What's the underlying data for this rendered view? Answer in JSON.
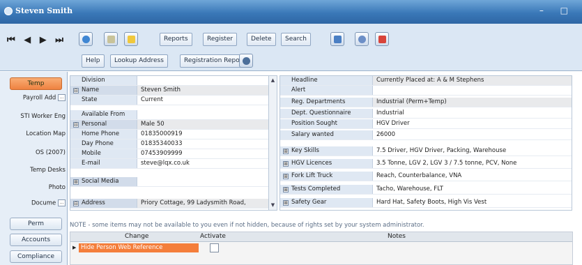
{
  "window": {
    "title": "Steven Smith",
    "controls": "– □"
  },
  "toolbar": {
    "nav_glyphs": "◄◄◄►►►",
    "nav": {
      "first": "⏮",
      "prev": "◀",
      "next": "▶",
      "last": "⏭"
    },
    "reports_label": "Reports",
    "register_label": "Register",
    "delete_label": "Delete",
    "search_label": "Search",
    "help_label": "Help",
    "lookup_address_label": "Lookup Address",
    "registration_report_label": "Registration Report",
    "accent": "#3a78b8"
  },
  "sidebar": {
    "tabs": [
      {
        "label": "Temp",
        "active": true
      },
      {
        "label": "Perm"
      },
      {
        "label": "Accounts"
      },
      {
        "label": "Compliance"
      }
    ],
    "items": [
      {
        "label": "Payroll Add",
        "selector": "…"
      },
      {
        "label": "STI Worker Eng"
      },
      {
        "label": "Location Map"
      },
      {
        "label": "OS (2007)"
      },
      {
        "label": "Temp Desks"
      },
      {
        "label": "Photo"
      },
      {
        "label": "Docume",
        "selector": "…"
      }
    ]
  },
  "left_grid": {
    "rows": [
      {
        "label": "Division",
        "value": ""
      },
      {
        "label": "Name",
        "value": "Steven Smith",
        "expander": "⊟"
      },
      {
        "label": "State",
        "value": "Current"
      },
      {
        "label": "Available From",
        "value": ""
      },
      {
        "label": "Personal",
        "value": "Male 50",
        "expander": "⊟"
      },
      {
        "label": "Home Phone",
        "value": "01835000919"
      },
      {
        "label": "Day Phone",
        "value": "01835340033"
      },
      {
        "label": "Mobile",
        "value": "07453909999"
      },
      {
        "label": "E-mail",
        "value": "steve@lqx.co.uk"
      },
      {
        "label": "Social Media",
        "value": "",
        "expander": "⊞"
      },
      {
        "label": "Address",
        "value": "Priory Cottage, 99 Ladysmith Road,",
        "expander": "⊟"
      }
    ]
  },
  "right_grid": {
    "rows": [
      {
        "label": "Headline",
        "value": "Currently Placed at: A & M Stephens"
      },
      {
        "label": "Alert",
        "value": ""
      },
      {
        "label": "Reg. Departments",
        "value": "Industrial (Perm+Temp)"
      },
      {
        "label": "Dept. Questionnaire",
        "value": "Industrial"
      },
      {
        "label": "Position Sought",
        "value": "HGV Driver"
      },
      {
        "label": "Salary wanted",
        "value": "26000"
      },
      {
        "label": "Key Skills",
        "value": "7.5 Driver, HGV Driver, Packing, Warehouse",
        "expander": "⊞"
      },
      {
        "label": "HGV Licences",
        "value": "3.5 Tonne, LGV 2, LGV 3 / 7.5 tonne, PCV, None",
        "expander": "⊞"
      },
      {
        "label": "Fork Lift Truck",
        "value": "Reach, Counterbalance, VNA",
        "expander": "⊞"
      },
      {
        "label": "Tests Completed",
        "value": "Tacho, Warehouse, FLT",
        "expander": "⊞"
      },
      {
        "label": "Safety Gear",
        "value": "Hard Hat, Safety Boots, High Vis Vest",
        "expander": "⊞"
      }
    ]
  },
  "note": "NOTE - some items may not be available to you even if not hidden, because of rights set by your system administrator.",
  "changes_table": {
    "headers": {
      "change": "Change",
      "activate": "Activate",
      "notes": "Notes"
    },
    "rows": [
      {
        "change": "Hide Person Web Reference",
        "activate": false,
        "notes": ""
      }
    ]
  },
  "scroll": {
    "up": "▲",
    "down": "▼"
  }
}
